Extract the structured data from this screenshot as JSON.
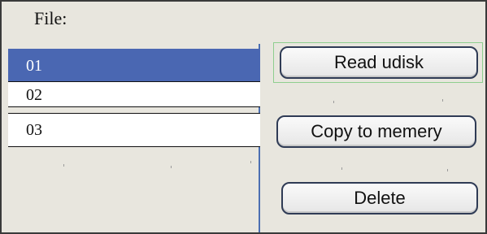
{
  "header": {
    "file_label": "File:"
  },
  "file_list": {
    "items": [
      {
        "label": "01",
        "selected": true
      },
      {
        "label": "02",
        "selected": false
      },
      {
        "label": "03",
        "selected": false
      }
    ]
  },
  "buttons": {
    "read_udisk": "Read udisk",
    "copy_to_memory": "Copy to memery",
    "delete": "Delete"
  },
  "colors": {
    "selection": "#4a67b2",
    "background": "#e8e6de",
    "focus_outline": "#8fcf8f"
  }
}
